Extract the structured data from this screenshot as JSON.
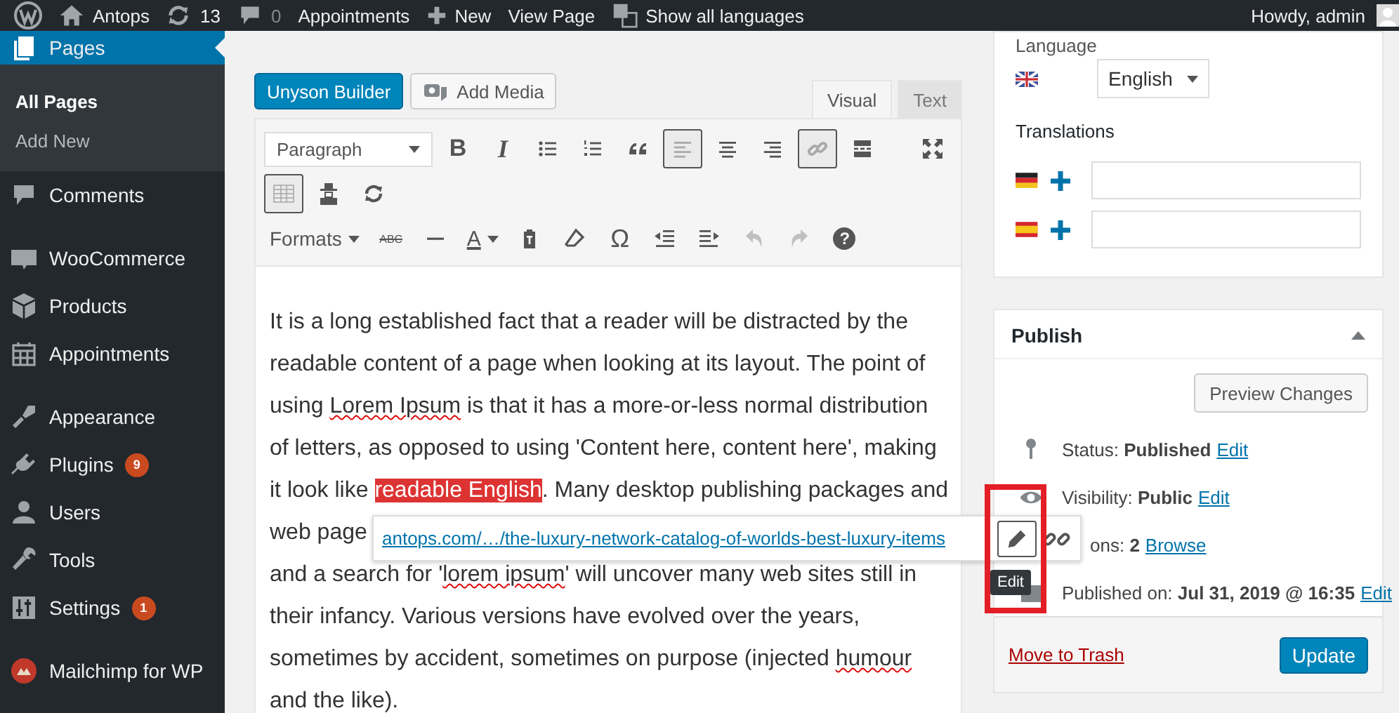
{
  "admin_bar": {
    "items": [
      {
        "kind": "wp-logo"
      },
      {
        "kind": "home",
        "label": "Antops"
      },
      {
        "kind": "updates",
        "label": "13"
      },
      {
        "kind": "comments",
        "label": "0"
      },
      {
        "kind": "plain",
        "label": "Appointments"
      },
      {
        "kind": "new",
        "label": "New"
      },
      {
        "kind": "plain",
        "label": "View Page"
      },
      {
        "kind": "translate",
        "label": "Show all languages"
      }
    ],
    "account": {
      "label": "Howdy, admin"
    }
  },
  "sidebar": {
    "groups": [
      [
        {
          "label": "Pages",
          "selected": true,
          "children": [
            {
              "label": "All Pages",
              "selected": true
            },
            {
              "label": "Add New",
              "selected": false
            }
          ]
        },
        {
          "label": "Comments",
          "selected": false
        }
      ],
      [
        {
          "label": "WooCommerce",
          "selected": false
        },
        {
          "label": "Products",
          "selected": false
        },
        {
          "label": "Appointments",
          "selected": false
        }
      ],
      [
        {
          "label": "Appearance",
          "selected": false
        },
        {
          "label": "Plugins",
          "selected": false,
          "badge": "9"
        },
        {
          "label": "Users",
          "selected": false
        },
        {
          "label": "Tools",
          "selected": false
        },
        {
          "label": "Settings",
          "selected": false,
          "badge": "1"
        }
      ],
      [
        {
          "label": "Mailchimp for WP",
          "selected": false
        }
      ]
    ]
  },
  "editor": {
    "buttons": [
      {
        "kind": "primary",
        "label": "Unyson Builder"
      },
      {
        "kind": "media",
        "label": "Add Media"
      }
    ],
    "tabs": [
      {
        "label": "Visual",
        "selected": true
      },
      {
        "label": "Text",
        "selected": false
      }
    ],
    "toolbar": [
      [
        {
          "kind": "format-select",
          "label": "Paragraph",
          "active": false,
          "disabled": false
        },
        {
          "kind": "bold",
          "label": "B",
          "active": false,
          "disabled": false
        },
        {
          "kind": "italic",
          "label": "I",
          "active": false,
          "disabled": false
        },
        {
          "kind": "bullet-list",
          "active": false,
          "disabled": false
        },
        {
          "kind": "numbered-list",
          "active": false,
          "disabled": false
        },
        {
          "kind": "blockquote",
          "active": false,
          "disabled": false
        },
        {
          "kind": "align-left",
          "active": true,
          "disabled": false
        },
        {
          "kind": "align-center",
          "active": false,
          "disabled": false
        },
        {
          "kind": "align-right",
          "active": false,
          "disabled": false
        },
        {
          "kind": "link",
          "active": true,
          "disabled": false
        },
        {
          "kind": "read-more",
          "active": false,
          "disabled": false
        },
        {
          "kind": "fullscreen",
          "active": false,
          "disabled": false
        }
      ],
      [
        {
          "kind": "table",
          "active": true,
          "disabled": false
        },
        {
          "kind": "person-hat",
          "active": false,
          "disabled": false
        },
        {
          "kind": "refresh",
          "active": false,
          "disabled": false
        }
      ],
      [
        {
          "kind": "formats-menu",
          "label": "Formats",
          "active": false,
          "disabled": false
        },
        {
          "kind": "strikethrough",
          "label": "ABC",
          "active": false,
          "disabled": false
        },
        {
          "kind": "horizontal-line",
          "active": false,
          "disabled": false
        },
        {
          "kind": "text-color",
          "label": "A",
          "active": false,
          "disabled": false
        },
        {
          "kind": "paste-text",
          "active": false,
          "disabled": false
        },
        {
          "kind": "clear-formatting",
          "active": false,
          "disabled": false
        },
        {
          "kind": "special-character",
          "label": "Ω",
          "active": false,
          "disabled": false
        },
        {
          "kind": "outdent",
          "active": false,
          "disabled": false
        },
        {
          "kind": "indent",
          "active": false,
          "disabled": false
        },
        {
          "kind": "undo",
          "active": false,
          "disabled": true
        },
        {
          "kind": "redo",
          "active": false,
          "disabled": true
        },
        {
          "kind": "help",
          "label": "?",
          "active": false,
          "disabled": false
        }
      ]
    ],
    "content_lines": [
      [
        {
          "kind": "plain",
          "text": "It is a long established fact that a reader will be distracted by the"
        }
      ],
      [
        {
          "kind": "plain",
          "text": "readable content of a page when looking at its layout. The point of"
        }
      ],
      [
        {
          "kind": "plain",
          "text": "using "
        },
        {
          "kind": "misspelled",
          "text": "Lorem Ipsum"
        },
        {
          "kind": "plain",
          "text": " is that it has a more-or-less normal distribution"
        }
      ],
      [
        {
          "kind": "plain",
          "text": "of letters, as opposed to using 'Content here, content here', making"
        }
      ],
      [
        {
          "kind": "plain",
          "text": "it look like "
        },
        {
          "kind": "link",
          "text": "readable English",
          "selected": true
        },
        {
          "kind": "plain",
          "text": ". Many desktop publishing packages and"
        }
      ],
      [
        {
          "kind": "plain",
          "text": "web page"
        }
      ],
      [
        {
          "kind": "plain",
          "text": "and a search for '"
        },
        {
          "kind": "misspelled",
          "text": "lorem ipsum"
        },
        {
          "kind": "plain",
          "text": "' will uncover many web sites still in"
        }
      ],
      [
        {
          "kind": "plain",
          "text": "their infancy. Various versions have evolved over the years,"
        }
      ],
      [
        {
          "kind": "plain",
          "text": "sometimes by accident, sometimes on purpose (injected "
        },
        {
          "kind": "misspelled",
          "text": "humour"
        }
      ],
      [
        {
          "kind": "plain",
          "text": "and the like)."
        }
      ]
    ],
    "link_popup": {
      "url": "antops.com/…/the-luxury-network-catalog-of-worlds-best-luxury-items",
      "tooltip": "Edit"
    }
  },
  "language_box": {
    "title": "Language",
    "language": "English",
    "translations_title": "Translations"
  },
  "publish_box": {
    "title": "Publish",
    "preview": "Preview Changes",
    "rows": [
      {
        "label": "Status:",
        "value": "Published",
        "link": "Edit"
      },
      {
        "label": "Visibility:",
        "value": "Public",
        "link": "Edit"
      },
      {
        "label": "ons:",
        "value": "2",
        "link": "Browse"
      },
      {
        "label": "Published on:",
        "value": "Jul 31, 2019 @ 16:35",
        "link": "Edit"
      }
    ],
    "trash": "Move to Trash",
    "update": "Update"
  }
}
